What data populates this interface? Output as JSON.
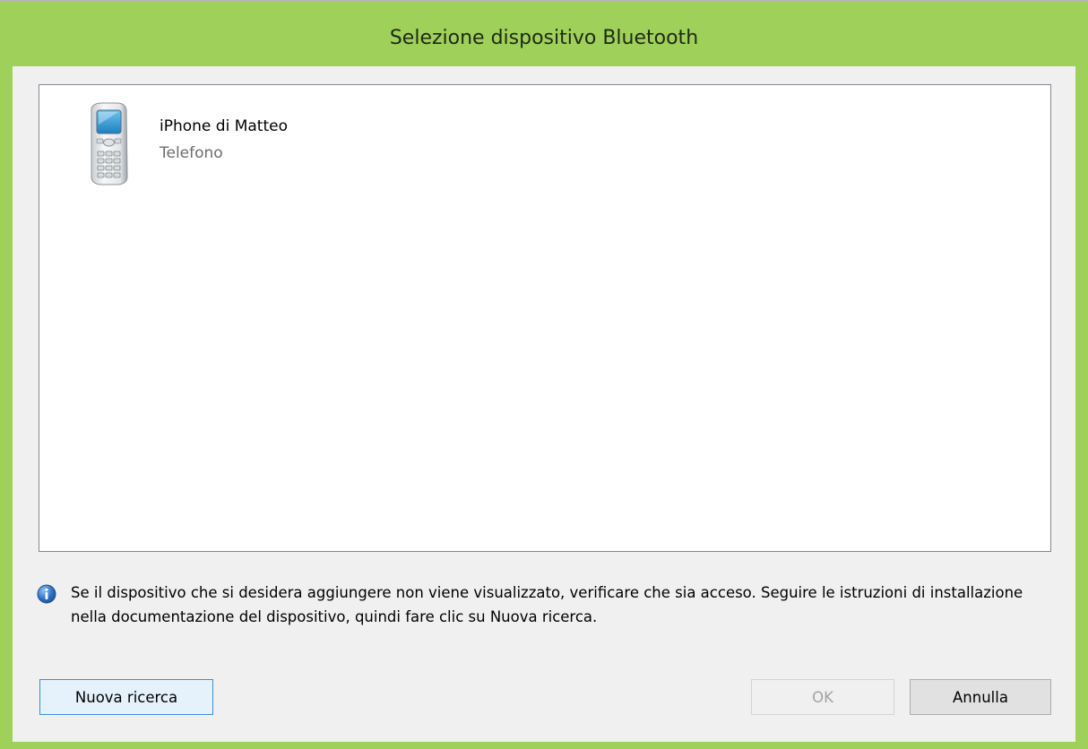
{
  "window": {
    "title": "Selezione dispositivo Bluetooth",
    "accent_color": "#9fd05a"
  },
  "device_list": {
    "items": [
      {
        "name": "iPhone di Matteo",
        "type": "Telefono",
        "icon": "mobile-phone-icon"
      }
    ]
  },
  "info": {
    "icon": "info-icon",
    "text": "Se il dispositivo che si desidera aggiungere non viene visualizzato, verificare che sia acceso. Seguire le istruzioni di installazione nella documentazione del dispositivo, quindi fare clic su Nuova ricerca."
  },
  "buttons": {
    "search_label": "Nuova ricerca",
    "ok_label": "OK",
    "ok_enabled": false,
    "cancel_label": "Annulla"
  }
}
